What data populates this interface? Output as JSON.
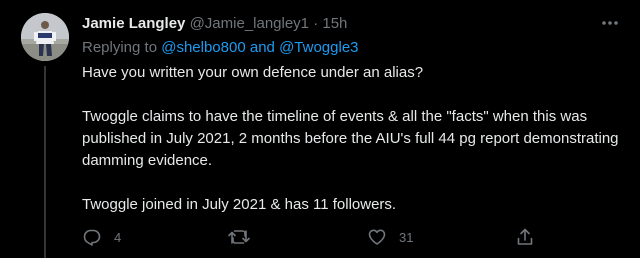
{
  "tweet": {
    "author": {
      "display_name": "Jamie Langley",
      "handle": "@Jamie_langley1",
      "separator": "·",
      "time": "15h",
      "avatar_icon": "profile-photo-icon"
    },
    "replying": {
      "prefix": "Replying to ",
      "mention1": "@shelbo800",
      "conjunction": " and ",
      "mention2": "@Twoggle3"
    },
    "body": {
      "paragraph1": "Have you written your own defence under an alias?",
      "paragraph2": "Twoggle claims to have the timeline of events & all the \"facts\" when this was published in July 2021, 2 months before the AIU's full 44 pg report demonstrating damming evidence.",
      "paragraph3": "Twoggle joined in July 2021 & has 11 followers."
    },
    "actions": {
      "reply_count": "4",
      "retweet_count": "",
      "like_count": "31",
      "reply_icon": "reply-icon",
      "retweet_icon": "retweet-icon",
      "like_icon": "heart-icon",
      "share_icon": "share-icon",
      "more_icon": "more-icon"
    }
  },
  "colors": {
    "background": "#000000",
    "primary_text": "#e7e9ea",
    "secondary_text": "#71767b",
    "link": "#1d9bf0",
    "thread_line": "#333639"
  }
}
